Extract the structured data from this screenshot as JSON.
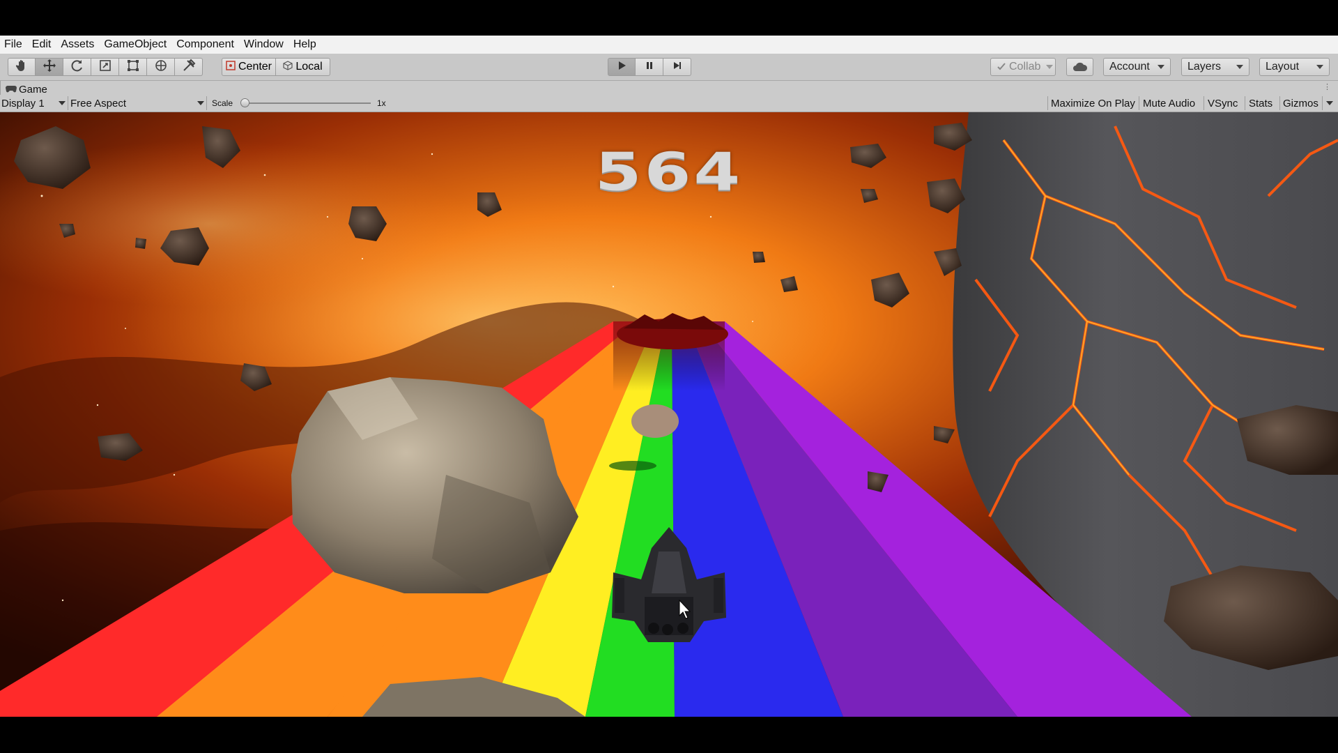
{
  "menu": [
    "File",
    "Edit",
    "Assets",
    "GameObject",
    "Component",
    "Window",
    "Help"
  ],
  "toolbar": {
    "tools": [
      {
        "icon": "hand-icon",
        "active": false
      },
      {
        "icon": "move-icon",
        "active": true
      },
      {
        "icon": "rotate-icon",
        "active": false
      },
      {
        "icon": "scale-icon",
        "active": false
      },
      {
        "icon": "rect-icon",
        "active": false
      },
      {
        "icon": "transform-icon",
        "active": false
      },
      {
        "icon": "custom-tool-icon",
        "active": false
      }
    ],
    "pivot_label": "Center",
    "space_label": "Local",
    "collab_label": "Collab",
    "account_label": "Account",
    "layers_label": "Layers",
    "layout_label": "Layout"
  },
  "game_panel": {
    "tab_label": "Game",
    "display_label": "Display 1",
    "aspect_label": "Free Aspect",
    "scale_label": "Scale",
    "scale_value": "1x",
    "scale_level": 0.0,
    "maximize_label": "Maximize On Play",
    "mute_label": "Mute Audio",
    "vsync_label": "VSync",
    "stats_label": "Stats",
    "gizmos_label": "Gizmos"
  },
  "game": {
    "score": "564",
    "track_colors": [
      "#ff2a2a",
      "#ff8c1a",
      "#ffee22",
      "#22dd22",
      "#2a2aee",
      "#7a22bb",
      "#a422dd"
    ]
  }
}
